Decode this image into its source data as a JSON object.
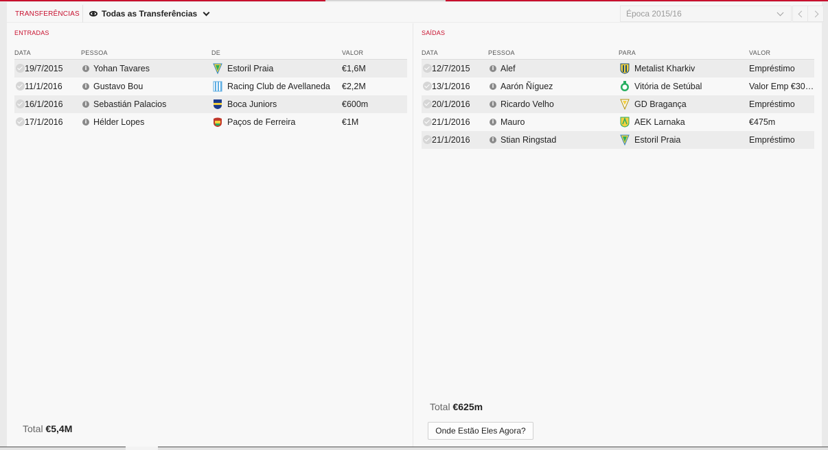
{
  "header": {
    "title": "TRANSFERÊNCIAS",
    "filter_label": "Todas as Transferências",
    "season_label": "Época 2015/16"
  },
  "colors": {
    "accent": "#c8102e",
    "row_alt": "#ececec",
    "background": "#f7f7f7"
  },
  "incoming": {
    "title": "ENTRADAS",
    "columns": {
      "date": "DATA",
      "person": "PESSOA",
      "club": "DE",
      "value": "VALOR"
    },
    "rows": [
      {
        "date": "19/7/2015",
        "person": "Yohan Tavares",
        "club": "Estoril Praia",
        "value": "€1,6M",
        "crest": "estoril-crest-icon"
      },
      {
        "date": "11/1/2016",
        "person": "Gustavo Bou",
        "club": "Racing Club de Avellaneda",
        "value": "€2,2M",
        "crest": "racing-crest-icon"
      },
      {
        "date": "16/1/2016",
        "person": "Sebastián Palacios",
        "club": "Boca Juniors",
        "value": "€600m",
        "crest": "boca-crest-icon"
      },
      {
        "date": "17/1/2016",
        "person": "Hélder Lopes",
        "club": "Paços de Ferreira",
        "value": "€1M",
        "crest": "pacos-crest-icon"
      }
    ],
    "total_label": "Total",
    "total_value": "€5,4M"
  },
  "outgoing": {
    "title": "SAÍDAS",
    "columns": {
      "date": "DATA",
      "person": "PESSOA",
      "club": "PARA",
      "value": "VALOR"
    },
    "rows": [
      {
        "date": "12/7/2015",
        "person": "Alef",
        "club": "Metalist Kharkiv",
        "value": "Empréstimo",
        "crest": "metalist-crest-icon"
      },
      {
        "date": "13/1/2016",
        "person": "Aarón Ñíguez",
        "club": "Vitória de Setúbal",
        "value": "Valor Emp €30…",
        "crest": "setubal-crest-icon"
      },
      {
        "date": "20/1/2016",
        "person": "Ricardo Velho",
        "club": "GD Bragança",
        "value": "Empréstimo",
        "crest": "braganca-crest-icon"
      },
      {
        "date": "21/1/2016",
        "person": "Mauro",
        "club": "AEK Larnaka",
        "value": "€475m",
        "crest": "aek-crest-icon"
      },
      {
        "date": "21/1/2016",
        "person": "Stian Ringstad",
        "club": "Estoril Praia",
        "value": "Empréstimo",
        "crest": "estoril-crest-icon"
      }
    ],
    "total_label": "Total",
    "total_value": "€625m",
    "button_label": "Onde Estão Eles Agora?"
  }
}
